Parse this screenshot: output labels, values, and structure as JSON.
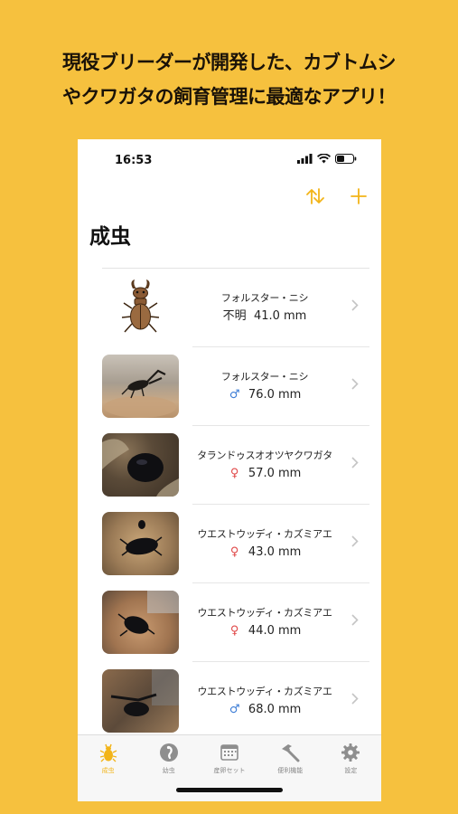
{
  "headline": {
    "line1": "現役ブリーダーが開発した、カブトムシ",
    "line2": "やクワガタの飼育管理に最適なアプリ！"
  },
  "status_bar": {
    "time": "16:53"
  },
  "page_title": "成虫",
  "list": [
    {
      "name": "フォルスター・ニシ",
      "sex": "",
      "sex_text": "不明",
      "size": "41.0 mm",
      "thumb": "illustration"
    },
    {
      "name": "フォルスター・ニシ",
      "sex": "♂",
      "size": "76.0 mm",
      "thumb": "photo"
    },
    {
      "name": "タランドゥスオオツヤクワガタ",
      "sex": "♀",
      "size": "57.0 mm",
      "thumb": "photo"
    },
    {
      "name": "ウエストウッディ・カズミアエ",
      "sex": "♀",
      "size": "43.0 mm",
      "thumb": "photo"
    },
    {
      "name": "ウエストウッディ・カズミアエ",
      "sex": "♀",
      "size": "44.0 mm",
      "thumb": "photo"
    },
    {
      "name": "ウエストウッディ・カズミアエ",
      "sex": "♂",
      "size": "68.0 mm",
      "thumb": "photo"
    }
  ],
  "tabs": [
    {
      "label": "成虫",
      "icon": "beetle-icon",
      "active": true
    },
    {
      "label": "幼虫",
      "icon": "larva-icon",
      "active": false
    },
    {
      "label": "産卵セット",
      "icon": "calendar-icon",
      "active": false
    },
    {
      "label": "便利機能",
      "icon": "hammer-icon",
      "active": false
    },
    {
      "label": "設定",
      "icon": "gear-icon",
      "active": false
    }
  ],
  "colors": {
    "background": "#f6c13e",
    "accent": "#f2b418",
    "male": "#3a7bd5",
    "female": "#e04848"
  }
}
